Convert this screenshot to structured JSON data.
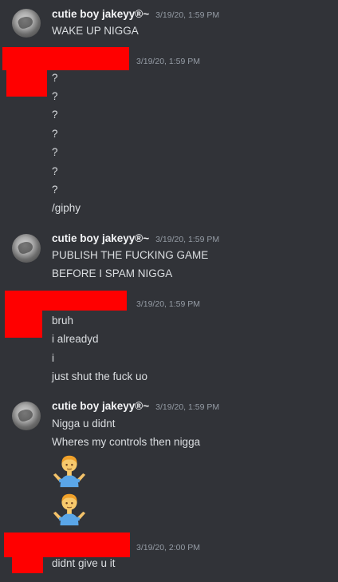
{
  "messages": [
    {
      "author": "cutie boy jakeyy®~",
      "timestamp": "3/19/20, 1:59 PM",
      "lines": [
        "WAKE UP NIGGA"
      ]
    },
    {
      "author": "",
      "timestamp": "3/19/20, 1:59 PM",
      "lines": [
        "?",
        "?",
        "?",
        "?",
        "?",
        "?",
        "?",
        "/giphy"
      ]
    },
    {
      "author": "cutie boy jakeyy®~",
      "timestamp": "3/19/20, 1:59 PM",
      "lines": [
        "PUBLISH THE FUCKING GAME",
        "BEFORE I SPAM NIGGA"
      ]
    },
    {
      "author": "",
      "timestamp": "3/19/20, 1:59 PM",
      "lines": [
        "bruh",
        "i alreadyd",
        "i",
        "just shut the fuck uo"
      ]
    },
    {
      "author": "cutie boy jakeyy®~",
      "timestamp": "3/19/20, 1:59 PM",
      "lines": [
        "Nigga u didnt",
        "Wheres my controls then nigga"
      ],
      "emojis": [
        "shrugging-man-emoji",
        "shrugging-man-emoji"
      ]
    },
    {
      "author": "",
      "timestamp": "3/19/20, 2:00 PM",
      "lines": [
        "didnt give u it"
      ]
    }
  ],
  "colors": {
    "background": "#313338",
    "username": "#f2f3f5",
    "message_text": "#dbdee1",
    "timestamp": "#949ba4",
    "redaction": "#ff0000"
  }
}
